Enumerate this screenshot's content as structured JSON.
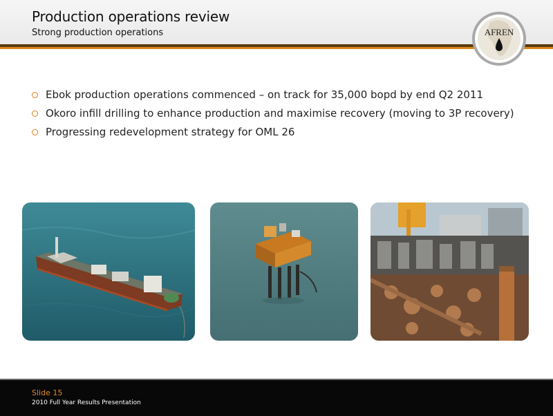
{
  "header": {
    "title": "Production operations review",
    "subtitle": "Strong production operations"
  },
  "logo": {
    "text": "AFREN"
  },
  "bullets": [
    "Ebok production operations commenced – on track for 35,000 bopd by end Q2 2011",
    "Okoro infill drilling to enhance production and maximise recovery (moving to 3P recovery)",
    "Progressing redevelopment strategy for OML 26"
  ],
  "photos": [
    {
      "name": "fpso-vessel-photo"
    },
    {
      "name": "offshore-platform-photo"
    },
    {
      "name": "platform-deck-equipment-photo"
    }
  ],
  "footer": {
    "slide": "Slide 15",
    "presentation": "2010 Full Year Results Presentation"
  },
  "colors": {
    "accent": "#e07b16",
    "rule_dark": "#5a3a10",
    "footer_bg": "#080808"
  }
}
